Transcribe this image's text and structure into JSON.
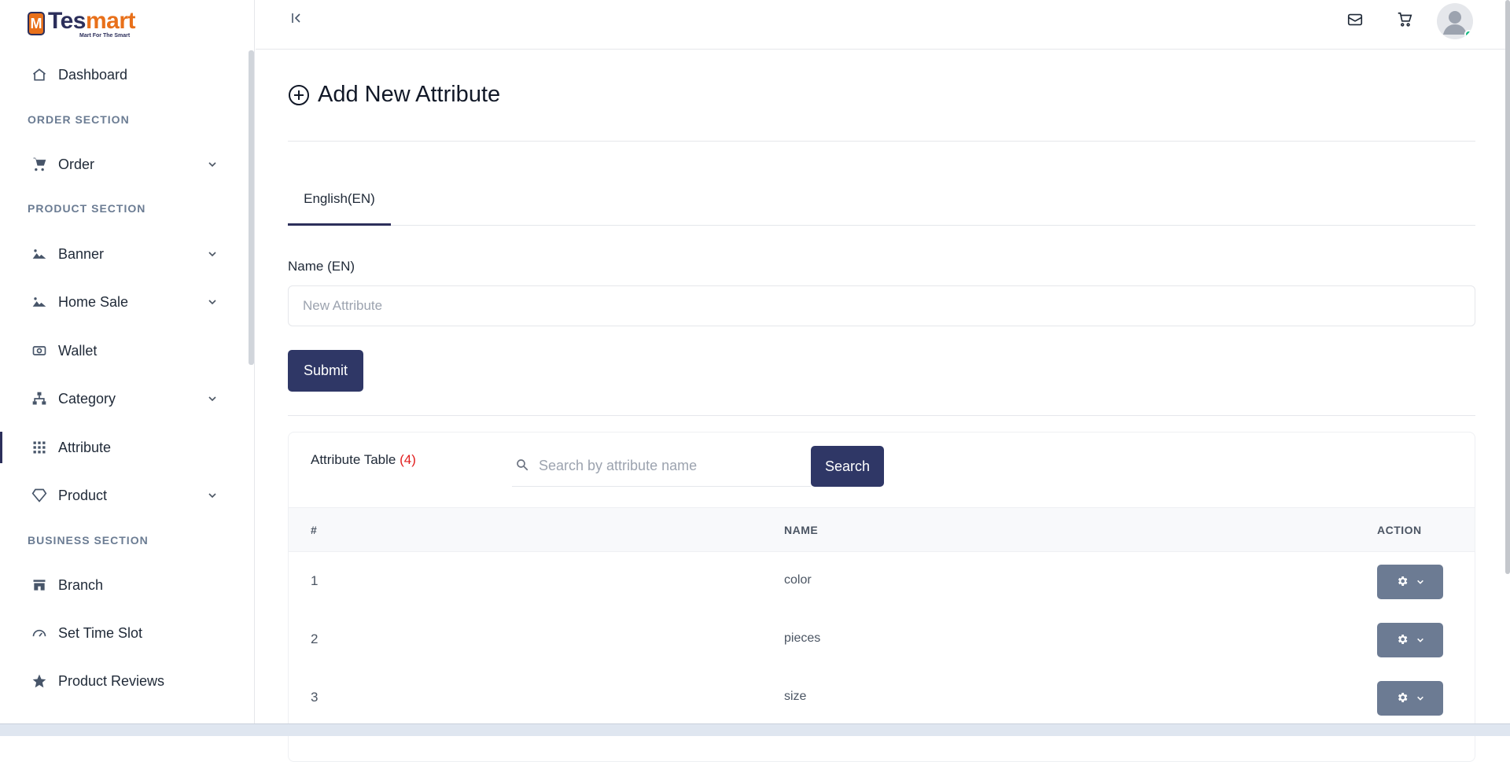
{
  "brand": {
    "name_part1": "Tes",
    "name_part2": "mart",
    "tagline": "Mart For The Smart",
    "mark": "M"
  },
  "sidebar": {
    "dashboard": "Dashboard",
    "sections": [
      "ORDER SECTION",
      "PRODUCT SECTION",
      "BUSINESS SECTION"
    ],
    "items": [
      {
        "label": "Order",
        "icon": "cart-icon",
        "has_children": true
      },
      {
        "label": "Banner",
        "icon": "image-icon",
        "has_children": true
      },
      {
        "label": "Home Sale",
        "icon": "image-icon",
        "has_children": true
      },
      {
        "label": "Wallet",
        "icon": "cash-icon",
        "has_children": false
      },
      {
        "label": "Category",
        "icon": "sitemap-icon",
        "has_children": true
      },
      {
        "label": "Attribute",
        "icon": "grid-icon",
        "has_children": false,
        "active": true
      },
      {
        "label": "Product",
        "icon": "diamond-icon",
        "has_children": true
      },
      {
        "label": "Branch",
        "icon": "store-icon",
        "has_children": false
      },
      {
        "label": "Set Time Slot",
        "icon": "speedometer-icon",
        "has_children": false
      },
      {
        "label": "Product Reviews",
        "icon": "star-icon",
        "has_children": false
      }
    ]
  },
  "page": {
    "title": "Add New Attribute",
    "tab": "English(EN)",
    "field_label": "Name (EN)",
    "field_placeholder": "New Attribute",
    "submit": "Submit"
  },
  "table": {
    "title": "Attribute Table",
    "count": "(4)",
    "search_placeholder": "Search by attribute name",
    "search_button": "Search",
    "columns": [
      "#",
      "NAME",
      "ACTION"
    ],
    "rows": [
      {
        "num": "1",
        "name": "color"
      },
      {
        "num": "2",
        "name": "pieces"
      },
      {
        "num": "3",
        "name": "size"
      }
    ]
  },
  "colors": {
    "primary": "#2f3766",
    "accent": "#e8701a",
    "count": "#e11d1d",
    "action": "#6c7b93",
    "online": "#10b981"
  }
}
